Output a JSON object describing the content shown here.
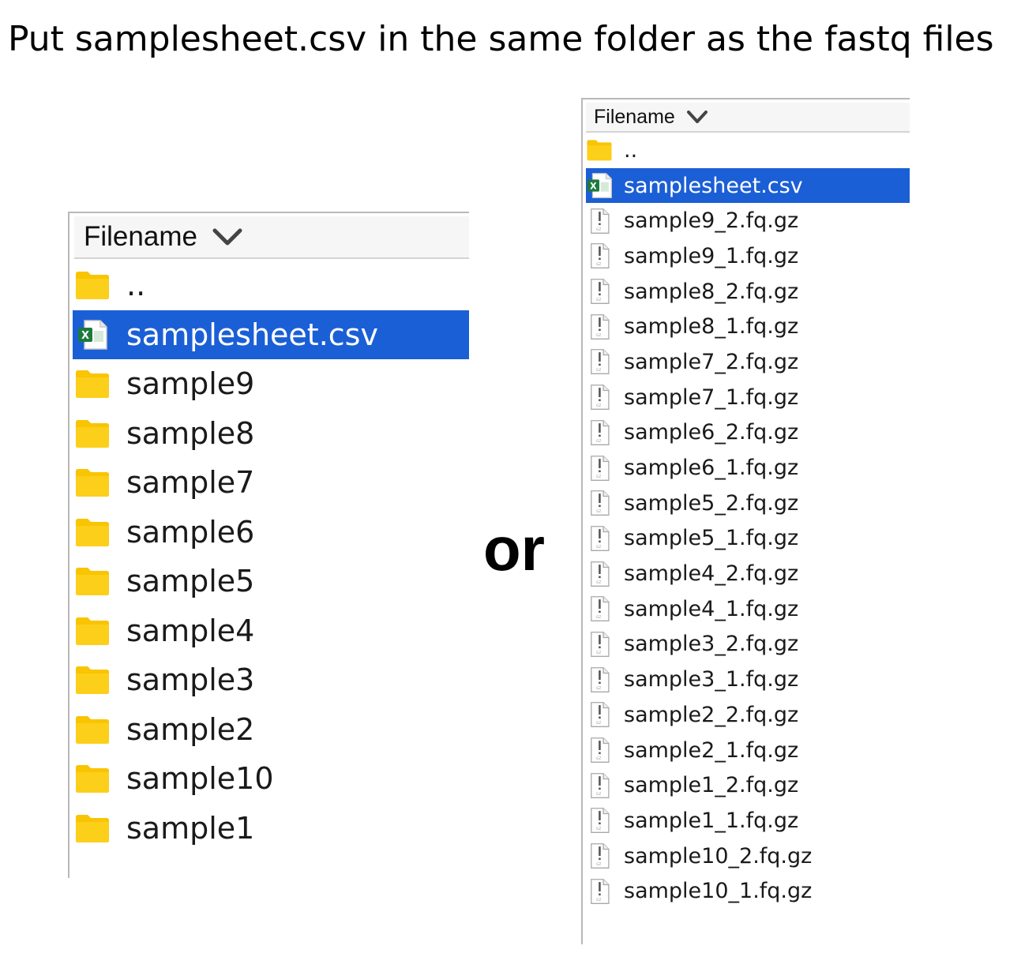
{
  "title": "Put samplesheet.csv in the same folder as the fastq files",
  "separator": "or",
  "colors": {
    "selection": "#1b5fd6",
    "folder": "#f9c400",
    "excel_green": "#1d7a3e"
  },
  "left_panel": {
    "header": "Filename",
    "header_icon": "chevron-down-icon",
    "rows": [
      {
        "label": "..",
        "icon": "folder-icon"
      },
      {
        "label": "samplesheet.csv",
        "icon": "csv-file-icon",
        "selected": true
      },
      {
        "label": "sample9",
        "icon": "folder-icon"
      },
      {
        "label": "sample8",
        "icon": "folder-icon"
      },
      {
        "label": "sample7",
        "icon": "folder-icon"
      },
      {
        "label": "sample6",
        "icon": "folder-icon"
      },
      {
        "label": "sample5",
        "icon": "folder-icon"
      },
      {
        "label": "sample4",
        "icon": "folder-icon"
      },
      {
        "label": "sample3",
        "icon": "folder-icon"
      },
      {
        "label": "sample2",
        "icon": "folder-icon"
      },
      {
        "label": "sample10",
        "icon": "folder-icon"
      },
      {
        "label": "sample1",
        "icon": "folder-icon"
      }
    ]
  },
  "right_panel": {
    "header": "Filename",
    "header_icon": "chevron-down-icon",
    "rows": [
      {
        "label": "..",
        "icon": "folder-icon"
      },
      {
        "label": "samplesheet.csv",
        "icon": "csv-file-icon",
        "selected": true
      },
      {
        "label": "sample9_2.fq.gz",
        "icon": "gz-file-icon"
      },
      {
        "label": "sample9_1.fq.gz",
        "icon": "gz-file-icon"
      },
      {
        "label": "sample8_2.fq.gz",
        "icon": "gz-file-icon"
      },
      {
        "label": "sample8_1.fq.gz",
        "icon": "gz-file-icon"
      },
      {
        "label": "sample7_2.fq.gz",
        "icon": "gz-file-icon"
      },
      {
        "label": "sample7_1.fq.gz",
        "icon": "gz-file-icon"
      },
      {
        "label": "sample6_2.fq.gz",
        "icon": "gz-file-icon"
      },
      {
        "label": "sample6_1.fq.gz",
        "icon": "gz-file-icon"
      },
      {
        "label": "sample5_2.fq.gz",
        "icon": "gz-file-icon"
      },
      {
        "label": "sample5_1.fq.gz",
        "icon": "gz-file-icon"
      },
      {
        "label": "sample4_2.fq.gz",
        "icon": "gz-file-icon"
      },
      {
        "label": "sample4_1.fq.gz",
        "icon": "gz-file-icon"
      },
      {
        "label": "sample3_2.fq.gz",
        "icon": "gz-file-icon"
      },
      {
        "label": "sample3_1.fq.gz",
        "icon": "gz-file-icon"
      },
      {
        "label": "sample2_2.fq.gz",
        "icon": "gz-file-icon"
      },
      {
        "label": "sample2_1.fq.gz",
        "icon": "gz-file-icon"
      },
      {
        "label": "sample1_2.fq.gz",
        "icon": "gz-file-icon"
      },
      {
        "label": "sample1_1.fq.gz",
        "icon": "gz-file-icon"
      },
      {
        "label": "sample10_2.fq.gz",
        "icon": "gz-file-icon"
      },
      {
        "label": "sample10_1.fq.gz",
        "icon": "gz-file-icon"
      }
    ]
  }
}
